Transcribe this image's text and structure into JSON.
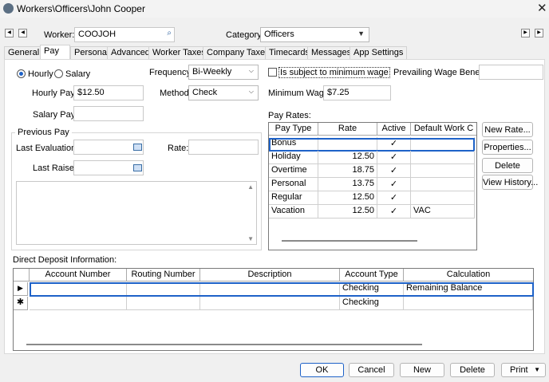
{
  "window": {
    "title": "Workers\\Officers\\John Cooper"
  },
  "toolbar": {
    "worker_label": "Worker:",
    "worker_value": "COOJOH",
    "category_label": "Category:",
    "category_value": "Officers"
  },
  "tabs": [
    "General",
    "Pay",
    "Personal",
    "Advanced",
    "Worker Taxes",
    "Company Taxes",
    "Timecards",
    "Messages",
    "App Settings"
  ],
  "pay": {
    "hourly_radio": "Hourly",
    "salary_radio": "Salary",
    "frequency_label": "Frequency:",
    "frequency_value": "Bi-Weekly",
    "subject_min_wage": "Is subject to minimum wage",
    "prevailing_wage_label": "Prevailing Wage Benefit:",
    "hourly_pay_label": "Hourly Pay:",
    "hourly_pay_value": "$12.50",
    "method_label": "Method:",
    "method_value": "Check",
    "min_wage_label": "Minimum Wage:",
    "min_wage_value": "$7.25",
    "salary_pay_label": "Salary Pay:",
    "pay_rates_label": "Pay Rates:"
  },
  "previous_pay": {
    "title": "Previous Pay",
    "last_eval_label": "Last Evaluation:",
    "rate_label": "Rate:",
    "last_raise_label": "Last Raise:"
  },
  "pay_rates": {
    "columns": [
      "Pay Type",
      "Rate",
      "Active",
      "Default Work C"
    ],
    "rows": [
      {
        "type": "Bonus",
        "rate": "",
        "active": "✓",
        "default": ""
      },
      {
        "type": "Holiday",
        "rate": "12.50",
        "active": "✓",
        "default": ""
      },
      {
        "type": "Overtime",
        "rate": "18.75",
        "active": "✓",
        "default": ""
      },
      {
        "type": "Personal",
        "rate": "13.75",
        "active": "✓",
        "default": ""
      },
      {
        "type": "Regular",
        "rate": "12.50",
        "active": "✓",
        "default": ""
      },
      {
        "type": "Vacation",
        "rate": "12.50",
        "active": "✓",
        "default": "VAC"
      }
    ]
  },
  "rate_buttons": {
    "new": "New Rate...",
    "properties": "Properties...",
    "delete": "Delete",
    "history": "View History..."
  },
  "direct_deposit": {
    "label": "Direct Deposit Information:",
    "columns": [
      "Account Number",
      "Routing Number",
      "Description",
      "Account Type",
      "Calculation"
    ],
    "rows": [
      {
        "account": "",
        "routing": "",
        "description": "",
        "type": "Checking",
        "calc": "Remaining Balance"
      },
      {
        "account": "",
        "routing": "",
        "description": "",
        "type": "Checking",
        "calc": ""
      }
    ]
  },
  "footer": {
    "ok": "OK",
    "cancel": "Cancel",
    "new": "New",
    "delete": "Delete",
    "print": "Print"
  },
  "colors": {
    "accent": "#1e62c8",
    "panel": "#ffffff",
    "chrome": "#f0f0f0"
  }
}
